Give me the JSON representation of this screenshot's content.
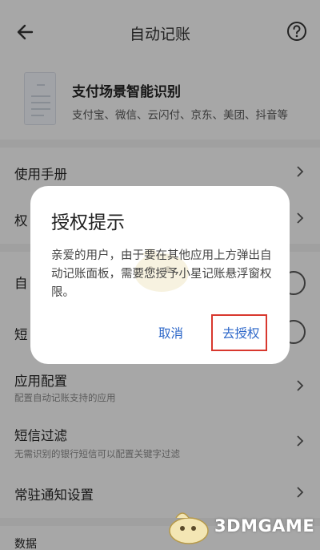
{
  "header": {
    "title": "自动记账"
  },
  "scene": {
    "title": "支付场景智能识别",
    "subtitle": "支付宝、微信、云闪付、京东、美团、抖音等"
  },
  "menu": {
    "manual": "使用手册",
    "permission_partial": "权",
    "auto_partial": "自",
    "sms_partial": "短",
    "app_config": {
      "title": "应用配置",
      "subtitle": "配置自动记账支持的应用"
    },
    "sms_filter": {
      "title": "短信过滤",
      "subtitle": "无需识别的银行短信可以配置关键字过滤"
    },
    "notify": "常驻通知设置",
    "data_partial": "数据"
  },
  "dialog": {
    "title": "授权提示",
    "body": "亲爱的用户，由于要在其他应用上方弹出自动记账面板，需要您授予小星记账悬浮窗权限。",
    "cancel": "取消",
    "authorize": "去授权"
  },
  "watermark": {
    "text": "3DMGAME"
  },
  "colors": {
    "accent": "#2a65c8",
    "highlight": "#d8382e",
    "overlay": "rgba(0,0,0,0.32)"
  }
}
